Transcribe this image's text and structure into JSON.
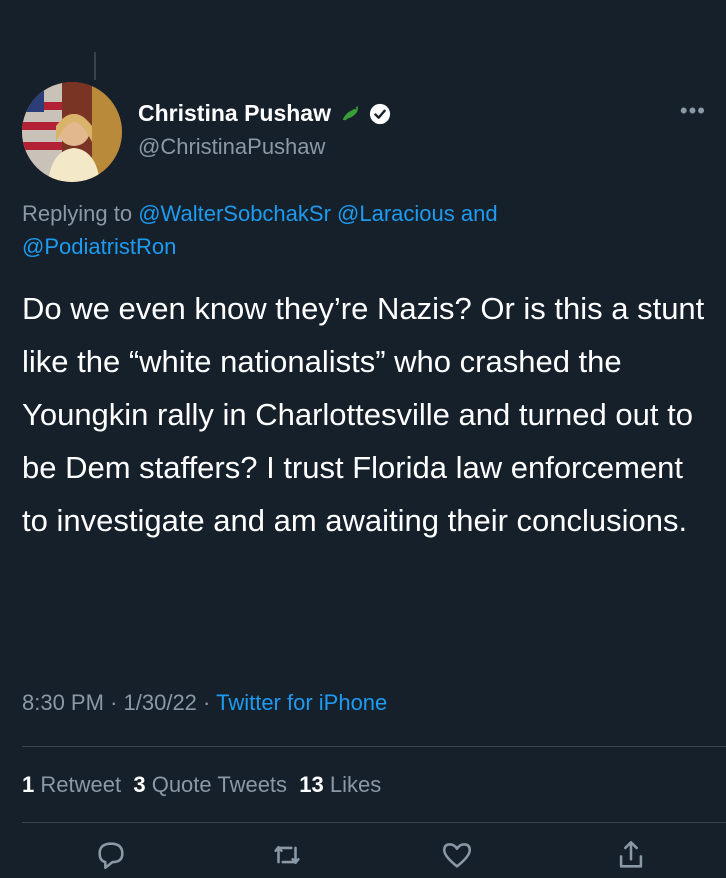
{
  "tweet": {
    "author_name": "Christina Pushaw",
    "author_handle": "@ChristinaPushaw",
    "replying_prefix": "Replying to",
    "reply_mentions": [
      "@WalterSobchakSr",
      "@Laracious",
      "and",
      "@PodiatristRon"
    ],
    "text": "Do we even know they’re Nazis? Or is this a stunt like the “white nationalists” who crashed the Youngkin rally in Charlottesville and turned out to be Dem staffers? I trust Florida law enforcement to investigate and am awaiting their conclusions.",
    "time": "8:30 PM",
    "date": "1/30/22",
    "source": "Twitter for iPhone",
    "separator": "·"
  },
  "stats": {
    "retweets_count": "1",
    "retweets_label": "Retweet",
    "quotes_count": "3",
    "quotes_label": "Quote Tweets",
    "likes_count": "13",
    "likes_label": "Likes"
  },
  "icons": {
    "more": "more-icon",
    "verified": "verified-badge-icon",
    "emoji": "lizard-emoji-icon",
    "reply": "reply-icon",
    "retweet": "retweet-icon",
    "like": "like-icon",
    "share": "share-icon"
  },
  "colors": {
    "background": "#15202b",
    "text": "#ffffff",
    "secondary_text": "#8b98a5",
    "link": "#1d9bf0",
    "divider": "#38444d"
  }
}
